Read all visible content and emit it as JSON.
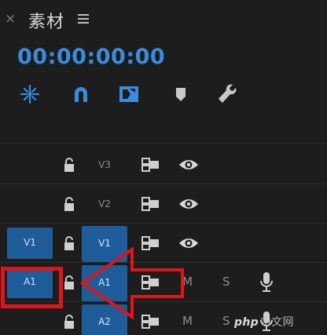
{
  "panel": {
    "title": "素材",
    "timecode": "00:00:00:00"
  },
  "toolbar": {
    "icons": [
      "insert-nest-icon",
      "snap-magnet-icon",
      "linked-selection-icon",
      "add-marker-icon",
      "settings-wrench-icon"
    ],
    "accent_color": "#3a8ce0"
  },
  "tracks": [
    {
      "id": "V3",
      "label": "V3",
      "kind": "video",
      "targeted": false,
      "source_patch": ""
    },
    {
      "id": "V2",
      "label": "V2",
      "kind": "video",
      "targeted": false,
      "source_patch": ""
    },
    {
      "id": "V1",
      "label": "V1",
      "kind": "video",
      "targeted": true,
      "source_patch": "V1"
    },
    {
      "id": "A1",
      "label": "A1",
      "kind": "audio",
      "targeted": true,
      "source_patch": "A1",
      "mute_label": "M",
      "solo_label": "S"
    },
    {
      "id": "A2",
      "label": "A2",
      "kind": "audio",
      "targeted": true,
      "source_patch": "",
      "mute_label": "M",
      "solo_label": "S"
    }
  ],
  "annotation": {
    "highlight_color": "#e0151b"
  },
  "watermark": {
    "brand": "php",
    "site": "中文网"
  }
}
